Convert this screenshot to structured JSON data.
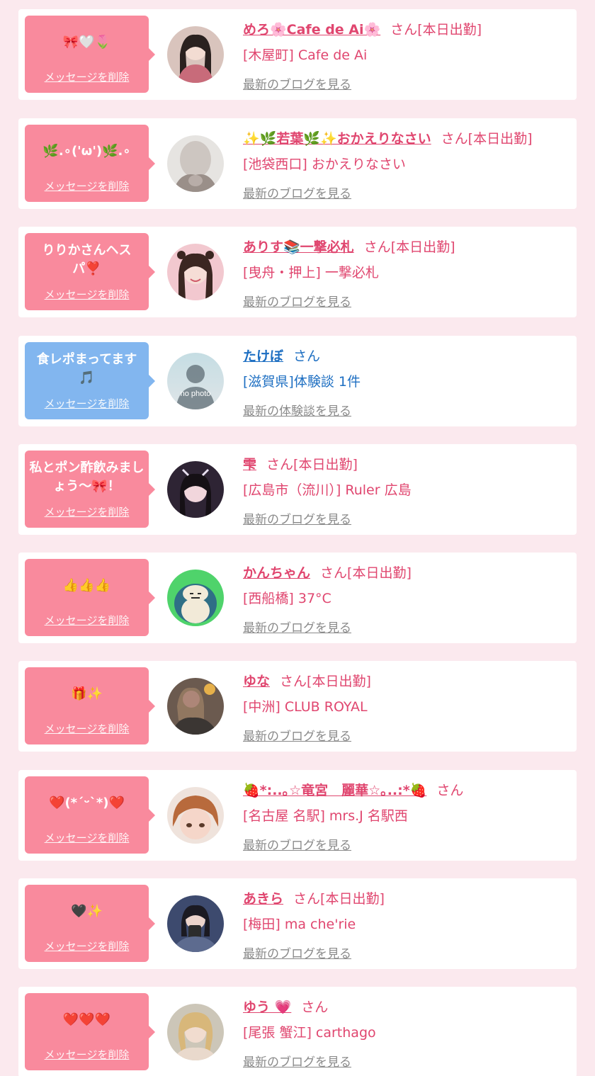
{
  "delete_label": "メッセージを削除",
  "colors": {
    "page_bg": "#fbe9ee",
    "bubble_pink": "#f98a9d",
    "bubble_blue": "#82b6ef",
    "name_pink": "#e0466f",
    "name_blue": "#1e6fc2",
    "link_gray": "#8a8a8a"
  },
  "items": [
    {
      "message": "🎀🤍🌷",
      "name": "めろ🌸Cafe de Ai🌸",
      "honorific": "さん",
      "status": "[本日出勤]",
      "location": "[木屋町] Cafe de Ai",
      "link": "最新のブログを見る",
      "theme": "pink",
      "avatar_icon": "girl-photo-icon"
    },
    {
      "message": "🌿.∘('ω')🌿.∘",
      "name": "✨🌿若葉🌿✨おかえりなさい",
      "honorific": "さん",
      "status": "[本日出勤]",
      "location": "[池袋西口] おかえりなさい",
      "link": "最新のブログを見る",
      "theme": "pink",
      "avatar_icon": "blurred-photo-icon"
    },
    {
      "message": "りりかさんヘスパ❣️",
      "name": "ありす📚一撃必札",
      "honorific": "さん",
      "status": "[本日出勤]",
      "location": "[曳舟・押上] 一撃必札",
      "link": "最新のブログを見る",
      "theme": "pink",
      "avatar_icon": "girl-photo-icon"
    },
    {
      "message": "食レポまってます🎵",
      "name": "たけぼ",
      "honorific": "さん",
      "status": "",
      "location": "[滋賀県]体験談 1件",
      "link": "最新の体験談を見る",
      "theme": "blue",
      "avatar_icon": "no-photo-icon",
      "avatar_text": "no photo"
    },
    {
      "message": "私とポン酢飲みましょう〜🎀！",
      "name": "雫",
      "honorific": "さん",
      "status": "[本日出勤]",
      "location": "[広島市（流川）] Ruler 広島",
      "link": "最新のブログを見る",
      "theme": "pink",
      "avatar_icon": "girl-photo-icon"
    },
    {
      "message": "👍👍👍",
      "name": "かんちゃん",
      "honorific": "さん",
      "status": "[本日出勤]",
      "location": "[西船橋] 37°C",
      "link": "最新のブログを見る",
      "theme": "pink",
      "avatar_icon": "snorlax-icon"
    },
    {
      "message": "🎁✨",
      "name": "ゆな",
      "honorific": "さん",
      "status": "[本日出勤]",
      "location": "[中洲] CLUB ROYAL",
      "link": "最新のブログを見る",
      "theme": "pink",
      "avatar_icon": "girl-photo-icon"
    },
    {
      "message": "❤️(*´ᵕ`*)❤️",
      "name": "🍓*:..｡☆竜宮　麗華☆｡..:*🍓",
      "honorific": "さん",
      "status": "",
      "location": "[名古屋 名駅] mrs.J 名駅西",
      "link": "最新のブログを見る",
      "theme": "pink",
      "avatar_icon": "girl-photo-icon"
    },
    {
      "message": "🖤✨",
      "name": "あきら",
      "honorific": "さん",
      "status": "[本日出勤]",
      "location": "[梅田] ma che'rie",
      "link": "最新のブログを見る",
      "theme": "pink",
      "avatar_icon": "girl-photo-icon"
    },
    {
      "message": "❤️❤️❤️",
      "name": "ゆう 💗",
      "honorific": "さん",
      "status": "",
      "location": "[尾張 蟹江] carthago",
      "link": "最新のブログを見る",
      "theme": "pink",
      "avatar_icon": "girl-photo-icon"
    }
  ]
}
